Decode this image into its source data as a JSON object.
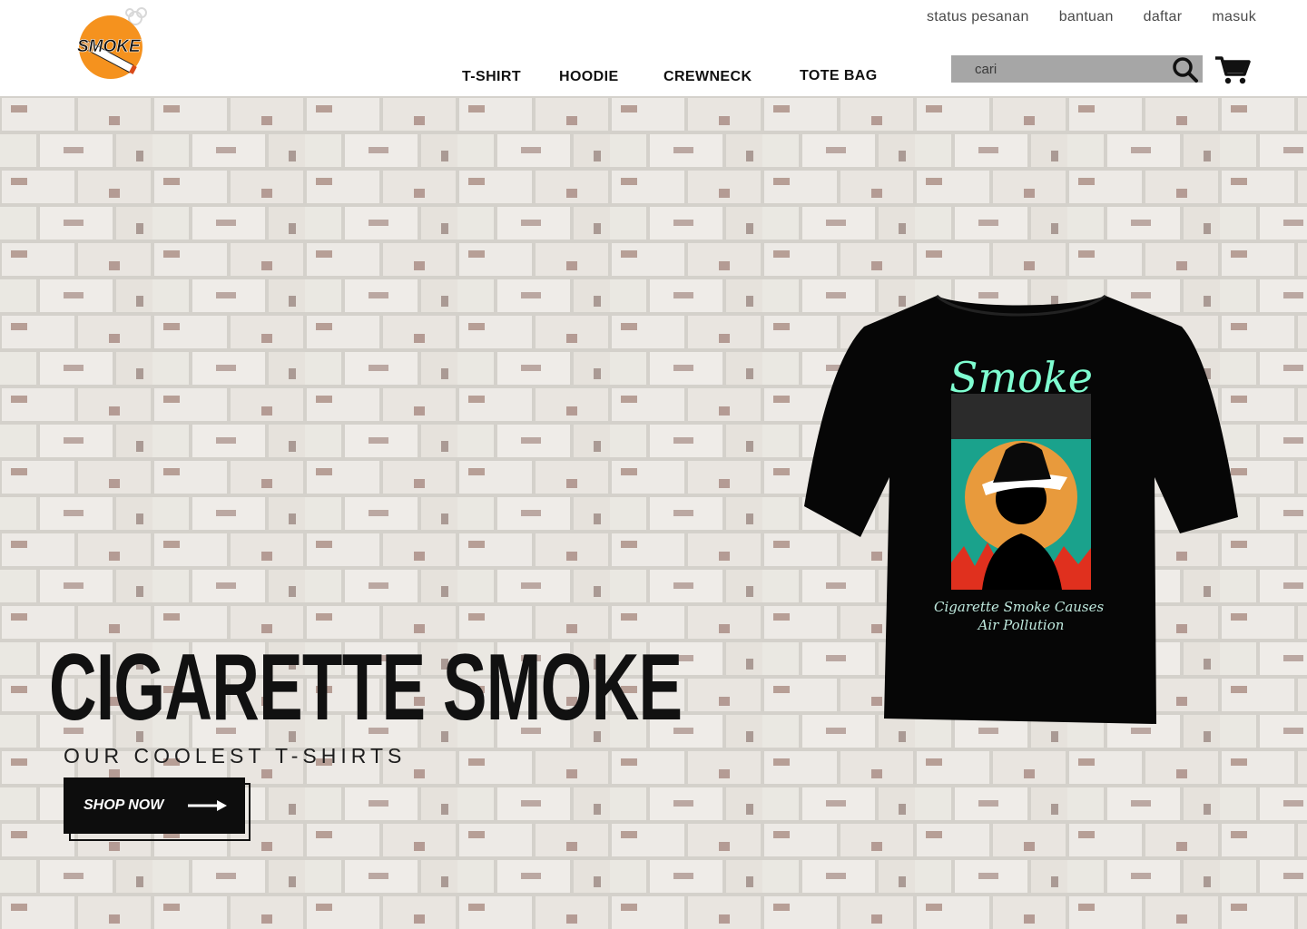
{
  "brand": {
    "logo_text": "SMOKE",
    "logo_icon": "smoke-cigarette-logo"
  },
  "top_links": [
    "status pesanan",
    "bantuan",
    "daftar",
    "masuk"
  ],
  "nav": {
    "items": [
      "T-SHIRT",
      "HOODIE",
      "CREWNECK",
      "TOTE BAG"
    ]
  },
  "search": {
    "placeholder": "cari",
    "value": "",
    "icon": "search-icon"
  },
  "cart": {
    "icon": "cart-icon"
  },
  "hero": {
    "title": "CIGARETTE SMOKE",
    "subtitle": "OUR COOLEST T-SHIRTS",
    "cta_label": "SHOP NOW",
    "cta_icon": "arrow-right-icon"
  },
  "product": {
    "shirt_print_title": "Smoke",
    "shirt_print_caption": "Cigarette Smoke Causes Air Pollution"
  },
  "colors": {
    "logo_orange": "#f5921e",
    "header_bg": "#ffffff",
    "search_bg": "#a6a6a6",
    "cta_bg": "#0d0d0d",
    "wall": "#e4e1dc",
    "brick_rust": "#6d3a2f"
  }
}
